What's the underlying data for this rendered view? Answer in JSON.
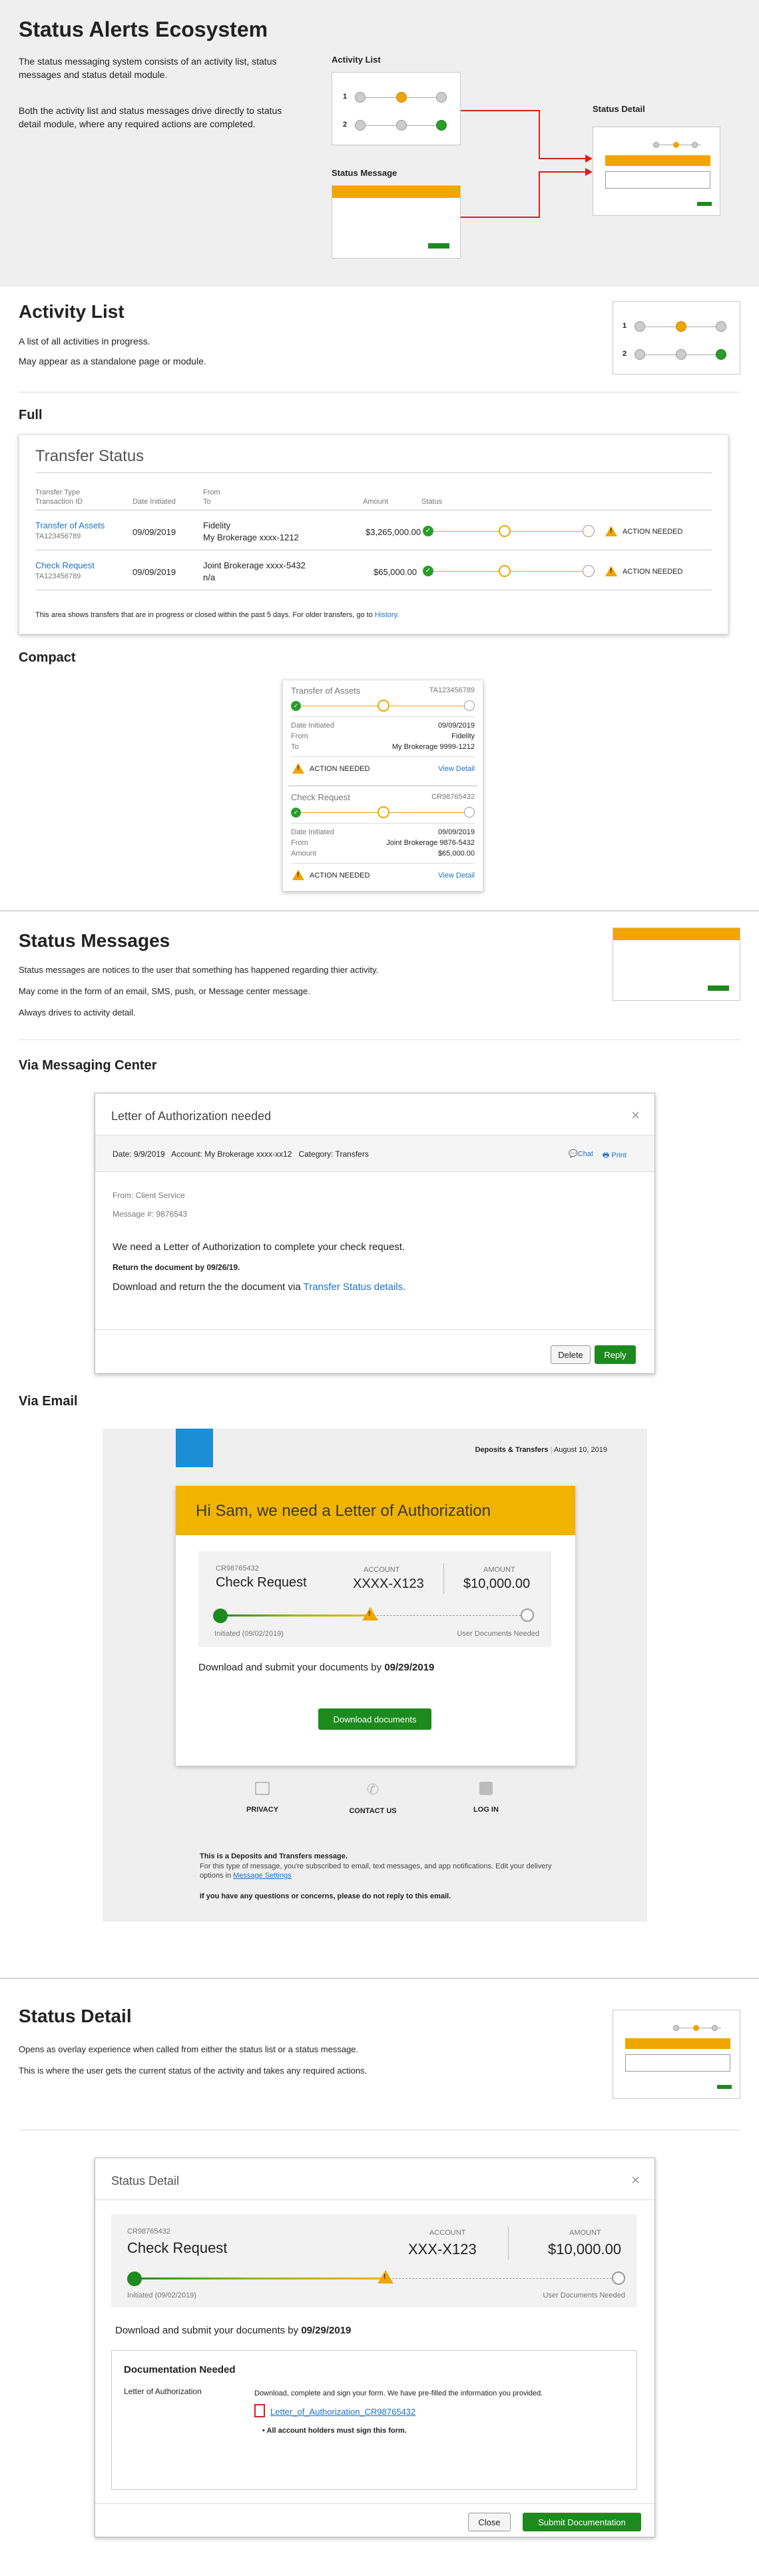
{
  "hero": {
    "title": "Status Alerts Ecosystem",
    "desc1": "The status messaging system consists of an activity list, status messages and status detail module.",
    "desc2": "Both the activity list and status messages drive directly to status detail module, where any required actions are completed.",
    "label_activity_list": "Activity List",
    "label_status_message": "Status Message",
    "label_status_detail": "Status Detail",
    "row1": "1",
    "row2": "2"
  },
  "activity": {
    "title": "Activity List",
    "desc1": "A list of all activities in progress.",
    "desc2": "May appear as a standalone page or module.",
    "full_label": "Full",
    "compact_label": "Compact"
  },
  "transfer": {
    "title": "Transfer Status",
    "col_type": "Transfer Type",
    "col_txn": "Transaction ID",
    "col_date": "Date Initiated",
    "col_from": "From",
    "col_to": "To",
    "col_amount": "Amount",
    "col_status": "Status",
    "rows": [
      {
        "type": "Transfer of Assets",
        "id": "TA123456789",
        "date": "09/09/2019",
        "from": "Fidelity",
        "to": "My Brokerage xxxx-1212",
        "amount": "$3,265,000.00",
        "action": "ACTION NEEDED"
      },
      {
        "type": "Check Request",
        "id": "TA123456789",
        "date": "09/09/2019",
        "from": "Joint Brokerage xxxx-5432",
        "to": "n/a",
        "amount": "$65,000.00",
        "action": "ACTION NEEDED"
      }
    ],
    "footer": "This area shows transfers that are in progress or closed within the past 5 days.  For older transfers, go to",
    "footer_link": "History."
  },
  "compact": {
    "cards": [
      {
        "type": "Transfer of Assets",
        "id": "TA123456789",
        "date_label": "Date Initiated",
        "date": "09/09/2019",
        "from_label": "From",
        "from": "Fidelity",
        "to_label": "To",
        "to": "My Brokerage 9999-1212",
        "action": "ACTION NEEDED",
        "link": "View Detail"
      },
      {
        "type": "Check Request",
        "id": "CR98765432",
        "date_label": "Date Initiated",
        "date": "09/09/2019",
        "from_label": "From",
        "from": "Joint Brokerage 9876-5432",
        "to_label": "Amount",
        "to": "$65,000.00",
        "action": "ACTION NEEDED",
        "link": "View Detail"
      }
    ]
  },
  "messages": {
    "title": "Status Messages",
    "desc1": "Status messages are notices to the user that something has happened regarding thier activity.",
    "desc2": "May come in the form of an email, SMS, push, or Message center message.",
    "desc3": "Always drives to activity detail.",
    "via_center": "Via Messaging Center",
    "via_email": "Via Email"
  },
  "msgcenter": {
    "title": "Letter of Authorization needed",
    "meta": "Date: 9/9/2019   Account: My Brokerage xxxx-xx12   Category: Transfers",
    "chat": "Chat",
    "print": "Print",
    "from": "From: Client Service",
    "msgnum": "Message #: 9876543",
    "body1": "We need a Letter of Authorization to complete your check request.",
    "body2": "Return the document by 09/26/19.",
    "body3": "Download and return the the document via",
    "body3_link": "Transfer Status details.",
    "delete": "Delete",
    "reply": "Reply"
  },
  "email": {
    "header_right_a": "Deposits & Transfers",
    "header_right_b": "August 10, 2019",
    "banner": "Hi Sam, we need a Letter of Authorization",
    "id": "CR98765432",
    "type": "Check Request",
    "account_label": "ACCOUNT",
    "account": "XXXX-X123",
    "amount_label": "AMOUNT",
    "amount": "$10,000.00",
    "initiated": "Initiated (09/02/2019)",
    "needed": "User Documents Needed",
    "submit_text": "Download and submit your documents by",
    "submit_date": "09/29/2019",
    "download": "Download documents",
    "privacy": "PRIVACY",
    "contact": "CONTACT US",
    "login": "LOG IN",
    "foot1": "This is a Deposits and Transfers message.",
    "foot2": "For this type of message, you're subscribed to email, text messages, and app notifications. Edit your delivery options in",
    "foot2_link": "Message Settings",
    "foot3": "If you have any questions or concerns, please do not reply to this email."
  },
  "detail": {
    "title": "Status Detail",
    "desc1": "Opens as overlay experience when called from either the status list or a status message.",
    "desc2": "This is where the user gets the current status of the activity and takes any required actions.",
    "modal_title": "Status Detail",
    "id": "CR98765432",
    "type": "Check Request",
    "account_label": "ACCOUNT",
    "account": "XXX-X123",
    "amount_label": "AMOUNT",
    "amount": "$10,000.00",
    "initiated": "Initiated (09/02/2019)",
    "needed": "User Documents Needed",
    "submit_text": "Download and submit your documents by",
    "submit_date": "09/29/2019",
    "doc_title": "Documentation Needed",
    "doc_name": "Letter of Authorization",
    "doc_instr": "Download, complete and sign your form. We have pre-filled the information you provided.",
    "doc_file": "Letter_of_Authorization_CR98765432",
    "doc_note": "All account holders must sign this form.",
    "close": "Close",
    "submit": "Submit Documentation"
  }
}
